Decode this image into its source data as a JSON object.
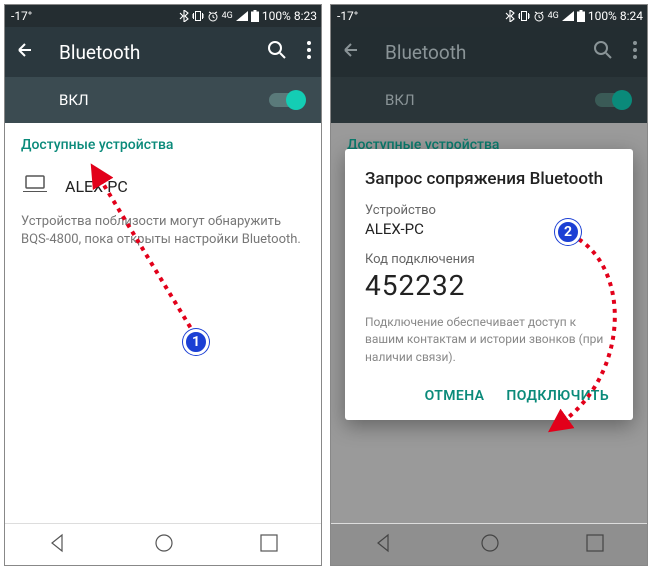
{
  "left": {
    "status": {
      "temp": "-17°",
      "battery": "100%",
      "time": "8:23"
    },
    "appbar": {
      "title": "Bluetooth"
    },
    "toggle": {
      "label": "ВКЛ"
    },
    "section": "Доступные устройства",
    "device": "ALEX-PC",
    "hint": "Устройства поблизости могут обнаружить BQS-4800, пока открыты настройки Bluetooth."
  },
  "right": {
    "status": {
      "temp": "-17°",
      "battery": "100%",
      "time": "8:24"
    },
    "appbar": {
      "title": "Bluetooth"
    },
    "toggle": {
      "label": "ВКЛ"
    },
    "section": "Доступные устройства",
    "dialog": {
      "title": "Запрос сопряжения Bluetooth",
      "device_label": "Устройство",
      "device": "ALEX-PC",
      "code_label": "Код подключения",
      "code": "452232",
      "hint": "Подключение обеспечивает доступ к вашим контактам и истории звонков (при наличии связи).",
      "cancel": "ОТМЕНА",
      "pair": "ПОДКЛЮЧИТЬ"
    }
  },
  "badges": {
    "one": "1",
    "two": "2"
  }
}
